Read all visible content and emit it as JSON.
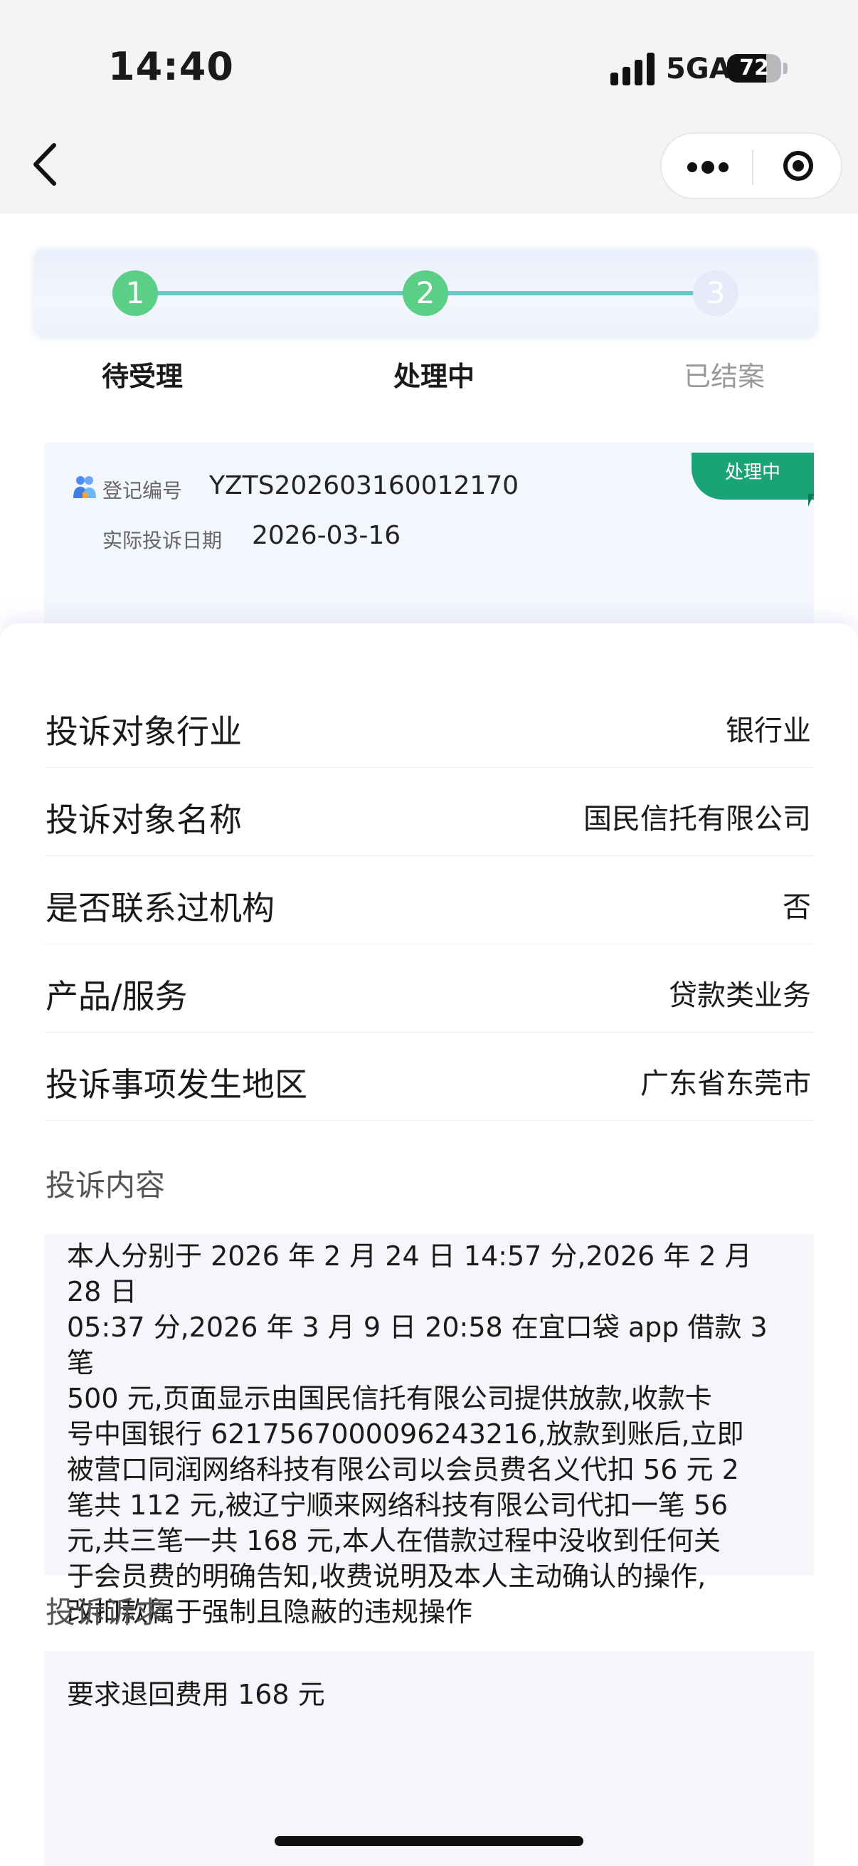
{
  "status_bar": {
    "time": "14:40",
    "network": "5GA",
    "battery": "72",
    "battery_level_percent": 72
  },
  "nav": {
    "back_icon": "chevron-left-icon",
    "more_icon": "more-dots-icon",
    "close_icon": "target-close-icon"
  },
  "steps": [
    {
      "number": "1",
      "label": "待受理",
      "state": "done"
    },
    {
      "number": "2",
      "label": "处理中",
      "state": "current"
    },
    {
      "number": "3",
      "label": "已结案",
      "state": "pending"
    }
  ],
  "record": {
    "status_badge": "处理中",
    "reg_no_label": "登记编号",
    "reg_no": "YZTS202603160012170",
    "date_label": "实际投诉日期",
    "date": "2026-03-16"
  },
  "details": [
    {
      "label": "投诉对象行业",
      "value": "银行业"
    },
    {
      "label": "投诉对象名称",
      "value": "国民信托有限公司"
    },
    {
      "label": "是否联系过机构",
      "value": "否"
    },
    {
      "label": "产品/服务",
      "value": "贷款类业务"
    },
    {
      "label": "投诉事项发生地区",
      "value": "广东省东莞市"
    }
  ],
  "complaint": {
    "content_title": "投诉内容",
    "content_lines": [
      "本人分别于 2026 年 2 月 24 日 14:57 分,2026 年 2 月 28 日",
      "05:37 分,2026 年 3 月 9 日 20:58 在宜口袋 app 借款 3 笔",
      "500 元,页面显示由国民信托有限公司提供放款,收款卡",
      "号中国银行 6217567000096243216,放款到账后,立即",
      "被营口同润网络科技有限公司以会员费名义代扣 56 元 2",
      "笔共 112 元,被辽宁顺来网络科技有限公司代扣一笔 56",
      "元,共三笔一共 168 元,本人在借款过程中没收到任何关",
      "于会员费的明确告知,收费说明及本人主动确认的操作,",
      "改扣款属于强制且隐蔽的违规操作"
    ],
    "demand_title": "投诉诉求",
    "demand": "要求退回费用 168 元"
  },
  "colors": {
    "accent_green": "#5ccf86",
    "line_teal": "#6cc5c6",
    "badge_green": "#1aa377"
  }
}
